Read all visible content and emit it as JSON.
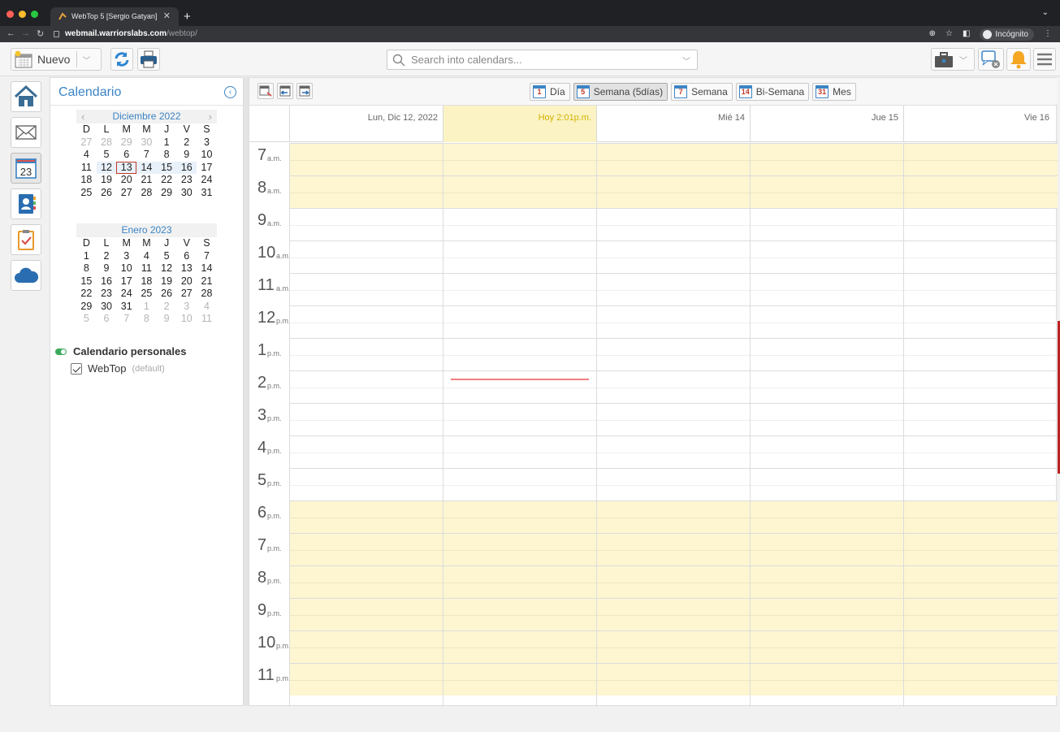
{
  "browser": {
    "tab_title": "WebTop 5 [Sergio Gatyan]",
    "url_host": "webmail.warriorslabs.com",
    "url_path": "/webtop/",
    "incognito_label": "Incógnito"
  },
  "toolbar": {
    "new_label": "Nuevo",
    "search_placeholder": "Search into calendars..."
  },
  "sidebar": {
    "title": "Calendario",
    "minical1": {
      "title": "Diciembre 2022",
      "dow": [
        "D",
        "L",
        "M",
        "M",
        "J",
        "V",
        "S"
      ],
      "weeks": [
        [
          "27",
          "28",
          "29",
          "30",
          "1",
          "2",
          "3"
        ],
        [
          "4",
          "5",
          "6",
          "7",
          "8",
          "9",
          "10"
        ],
        [
          "11",
          "12",
          "13",
          "14",
          "15",
          "16",
          "17"
        ],
        [
          "18",
          "19",
          "20",
          "21",
          "22",
          "23",
          "24"
        ],
        [
          "25",
          "26",
          "27",
          "28",
          "29",
          "30",
          "31"
        ]
      ]
    },
    "minical2": {
      "title": "Enero 2023",
      "dow": [
        "D",
        "L",
        "M",
        "M",
        "J",
        "V",
        "S"
      ],
      "weeks": [
        [
          "1",
          "2",
          "3",
          "4",
          "5",
          "6",
          "7"
        ],
        [
          "8",
          "9",
          "10",
          "11",
          "12",
          "13",
          "14"
        ],
        [
          "15",
          "16",
          "17",
          "18",
          "19",
          "20",
          "21"
        ],
        [
          "22",
          "23",
          "24",
          "25",
          "26",
          "27",
          "28"
        ],
        [
          "29",
          "30",
          "31",
          "1",
          "2",
          "3",
          "4"
        ],
        [
          "5",
          "6",
          "7",
          "8",
          "9",
          "10",
          "11"
        ]
      ]
    },
    "section_title": "Calendario personales",
    "calendar_name": "WebTop",
    "calendar_note": "(default)"
  },
  "views": [
    {
      "icon": "1",
      "label": "Día"
    },
    {
      "icon": "5",
      "label": "Semana (5días)"
    },
    {
      "icon": "7",
      "label": "Semana"
    },
    {
      "icon": "14",
      "label": "Bi-Semana"
    },
    {
      "icon": "31",
      "label": "Mes"
    }
  ],
  "active_view": "Semana (5días)",
  "day_headers": [
    "Lun, Dic 12, 2022",
    "Hoy 2:01p.m.",
    "Mié 14",
    "Jue 15",
    "Vie 16"
  ],
  "hours": [
    {
      "h": "7",
      "ap": "a.m."
    },
    {
      "h": "8",
      "ap": "a.m."
    },
    {
      "h": "9",
      "ap": "a.m."
    },
    {
      "h": "10",
      "ap": "a.m."
    },
    {
      "h": "11",
      "ap": "a.m."
    },
    {
      "h": "12",
      "ap": "p.m."
    },
    {
      "h": "1",
      "ap": "p.m."
    },
    {
      "h": "2",
      "ap": "p.m."
    },
    {
      "h": "3",
      "ap": "p.m."
    },
    {
      "h": "4",
      "ap": "p.m."
    },
    {
      "h": "5",
      "ap": "p.m."
    },
    {
      "h": "6",
      "ap": "p.m."
    },
    {
      "h": "7",
      "ap": "p.m."
    },
    {
      "h": "8",
      "ap": "p.m."
    },
    {
      "h": "9",
      "ap": "p.m."
    },
    {
      "h": "10",
      "ap": "p.m."
    },
    {
      "h": "11",
      "ap": "p.m."
    }
  ],
  "colors": {
    "accent": "#3b84c5",
    "offhours": "#fdf6d1",
    "today": "#fbf3c4",
    "now_line": "#f08080"
  }
}
